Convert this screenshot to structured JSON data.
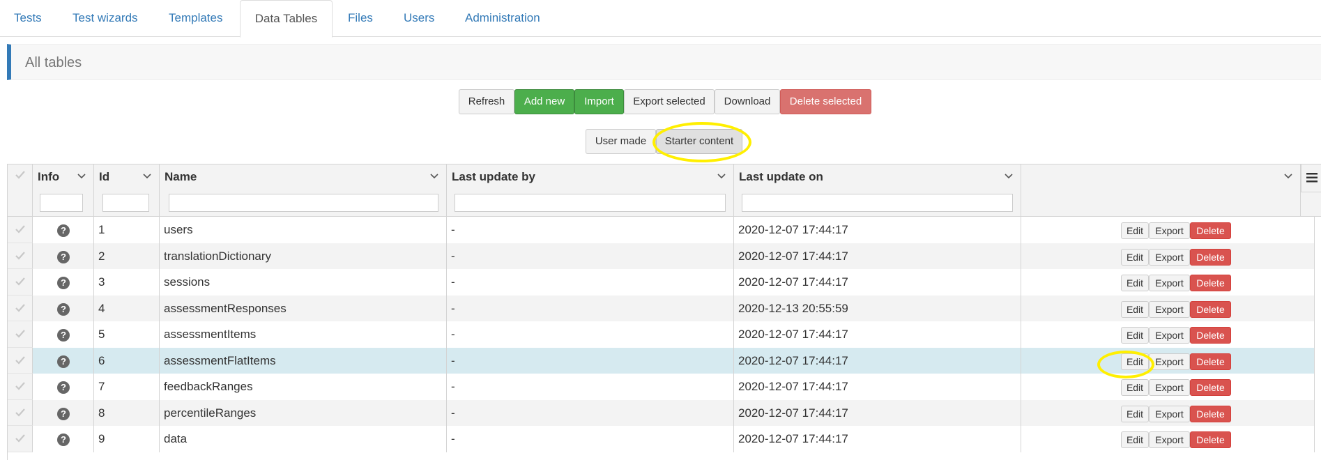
{
  "nav": {
    "tabs": [
      {
        "label": "Tests"
      },
      {
        "label": "Test wizards"
      },
      {
        "label": "Templates"
      },
      {
        "label": "Data Tables"
      },
      {
        "label": "Files"
      },
      {
        "label": "Users"
      },
      {
        "label": "Administration"
      }
    ],
    "active": "Data Tables"
  },
  "panel": {
    "title": "All tables"
  },
  "toolbar": {
    "refresh": "Refresh",
    "add_new": "Add new",
    "import": "Import",
    "export_selected": "Export selected",
    "download": "Download",
    "delete_selected": "Delete selected"
  },
  "filter_toggle": {
    "user_made": "User made",
    "starter_content": "Starter content",
    "selected": "Starter content"
  },
  "grid": {
    "columns": [
      "Info",
      "Id",
      "Name",
      "Last update by",
      "Last update on",
      ""
    ],
    "row_actions": {
      "edit": "Edit",
      "export": "Export",
      "delete": "Delete"
    },
    "rows": [
      {
        "id": "1",
        "name": "users",
        "updated_by": "-",
        "updated_on": "2020-12-07 17:44:17"
      },
      {
        "id": "2",
        "name": "translationDictionary",
        "updated_by": "-",
        "updated_on": "2020-12-07 17:44:17"
      },
      {
        "id": "3",
        "name": "sessions",
        "updated_by": "-",
        "updated_on": "2020-12-07 17:44:17"
      },
      {
        "id": "4",
        "name": "assessmentResponses",
        "updated_by": "-",
        "updated_on": "2020-12-13 20:55:59"
      },
      {
        "id": "5",
        "name": "assessmentItems",
        "updated_by": "-",
        "updated_on": "2020-12-07 17:44:17"
      },
      {
        "id": "6",
        "name": "assessmentFlatItems",
        "updated_by": "-",
        "updated_on": "2020-12-07 17:44:17"
      },
      {
        "id": "7",
        "name": "feedbackRanges",
        "updated_by": "-",
        "updated_on": "2020-12-07 17:44:17"
      },
      {
        "id": "8",
        "name": "percentileRanges",
        "updated_by": "-",
        "updated_on": "2020-12-07 17:44:17"
      },
      {
        "id": "9",
        "name": "data",
        "updated_by": "-",
        "updated_on": "2020-12-07 17:44:17"
      }
    ],
    "highlighted_row": "6"
  },
  "colors": {
    "link": "#337ab7",
    "success": "#4cae4c",
    "danger": "#d9534f",
    "selected_row": "#d6eaf0",
    "annotation": "#ffef00"
  },
  "icons": {
    "info": "question-circle-icon",
    "row_select": "check-icon",
    "column_menu": "chevron-down-icon",
    "grid_menu": "hamburger-menu-icon"
  }
}
